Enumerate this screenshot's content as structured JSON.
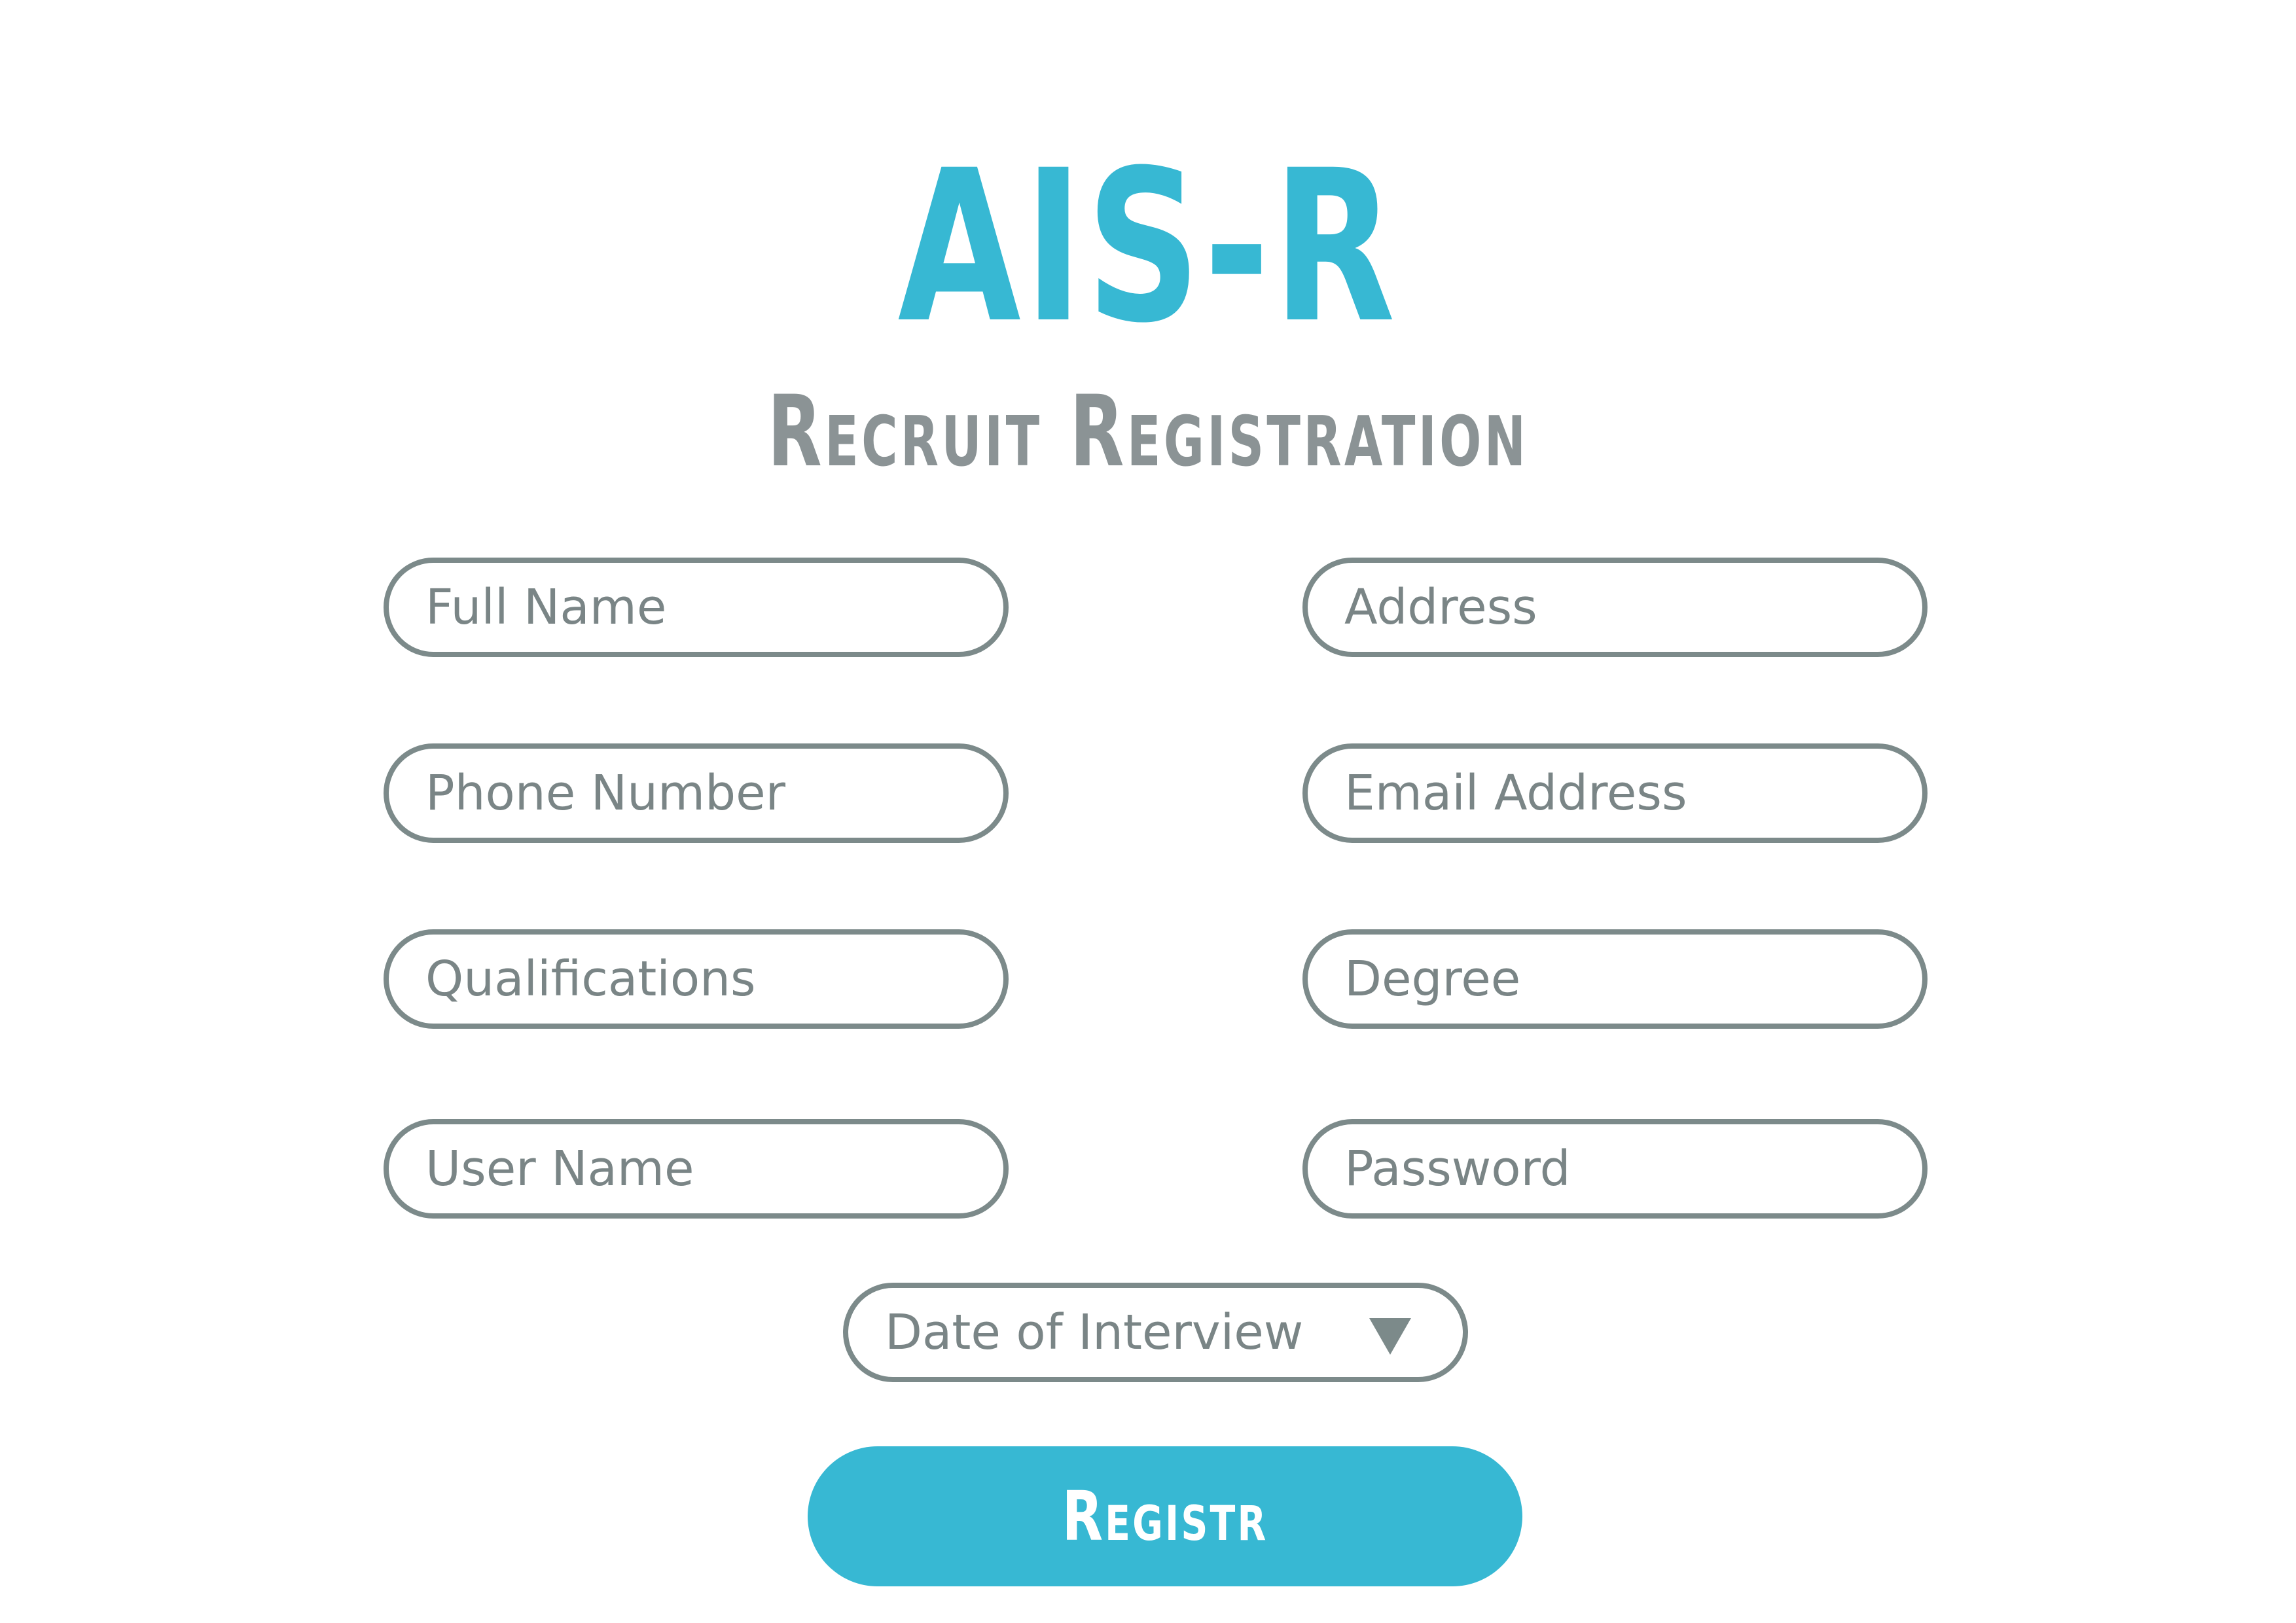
{
  "header": {
    "app_title": "AIS-R",
    "subtitle": "Recruit Registration"
  },
  "form": {
    "fields": {
      "full_name": {
        "placeholder": "Full Name"
      },
      "address": {
        "placeholder": "Address"
      },
      "phone_number": {
        "placeholder": "Phone Number"
      },
      "email_address": {
        "placeholder": "Email Address"
      },
      "qualifications": {
        "placeholder": "Qualifications"
      },
      "degree": {
        "placeholder": "Degree"
      },
      "user_name": {
        "placeholder": "User Name"
      },
      "password": {
        "placeholder": "Password"
      }
    },
    "interview_date_select": {
      "placeholder": "Date of Interview",
      "icon": "triangle-down-icon"
    },
    "submit_label": "Registr"
  },
  "colors": {
    "accent": "#37b8d3",
    "subtitle": "#8b9395",
    "field_border": "#7c8a8a",
    "field_text": "#7a8586",
    "button_text": "#ffffff",
    "background": "#ffffff"
  }
}
